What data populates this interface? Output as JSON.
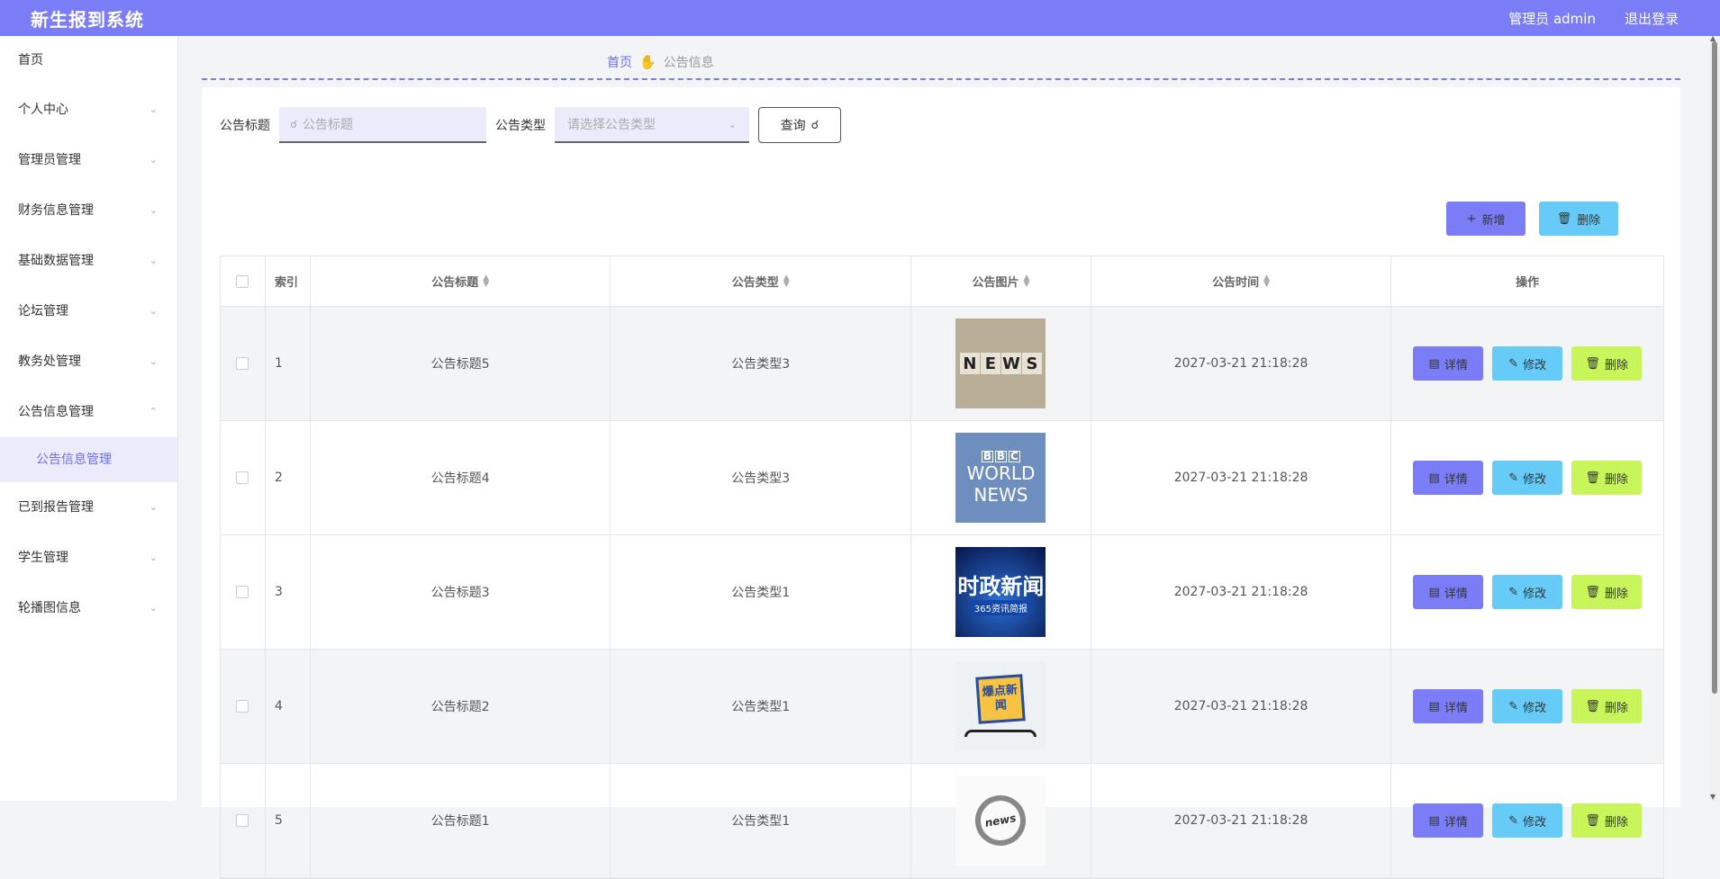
{
  "header": {
    "title": "新生报到系统",
    "user_label": "管理员 admin",
    "logout_label": "退出登录"
  },
  "sidebar": {
    "items": [
      {
        "label": "首页"
      },
      {
        "label": "个人中心"
      },
      {
        "label": "管理员管理"
      },
      {
        "label": "财务信息管理"
      },
      {
        "label": "基础数据管理"
      },
      {
        "label": "论坛管理"
      },
      {
        "label": "教务处管理"
      },
      {
        "label": "公告信息管理"
      },
      {
        "label": "已到报告管理"
      },
      {
        "label": "学生管理"
      },
      {
        "label": "轮播图信息"
      }
    ],
    "submenu_active": "公告信息管理"
  },
  "breadcrumb": {
    "home": "首页",
    "current": "公告信息"
  },
  "search": {
    "title_label": "公告标题",
    "title_placeholder": "公告标题",
    "type_label": "公告类型",
    "type_placeholder": "请选择公告类型",
    "query_label": "查询"
  },
  "actions": {
    "add_label": "新增",
    "delete_label": "删除"
  },
  "table": {
    "columns": [
      "索引",
      "公告标题",
      "公告类型",
      "公告图片",
      "公告时间",
      "操作"
    ],
    "rows": [
      {
        "index": "1",
        "title": "公告标题5",
        "type": "公告类型3",
        "time": "2027-03-21 21:18:28"
      },
      {
        "index": "2",
        "title": "公告标题4",
        "type": "公告类型3",
        "time": "2027-03-21 21:18:28"
      },
      {
        "index": "3",
        "title": "公告标题3",
        "type": "公告类型1",
        "time": "2027-03-21 21:18:28"
      },
      {
        "index": "4",
        "title": "公告标题2",
        "type": "公告类型1",
        "time": "2027-03-21 21:18:28"
      },
      {
        "index": "5",
        "title": "公告标题1",
        "type": "公告类型1",
        "time": "2027-03-21 21:18:28"
      }
    ],
    "ops": {
      "detail": "详情",
      "edit": "修改",
      "delete": "删除"
    }
  },
  "images": {
    "row1_text": "NEWS",
    "row2_text": [
      "BBC",
      "WORLD",
      "NEWS"
    ],
    "row3_text": [
      "时政新闻",
      "365资讯简报"
    ],
    "row4_text": "爆点新闻",
    "row5_text": "news"
  },
  "colors": {
    "accent": "#7b7df6",
    "edit": "#66ccf7",
    "delete": "#c8f55a"
  }
}
